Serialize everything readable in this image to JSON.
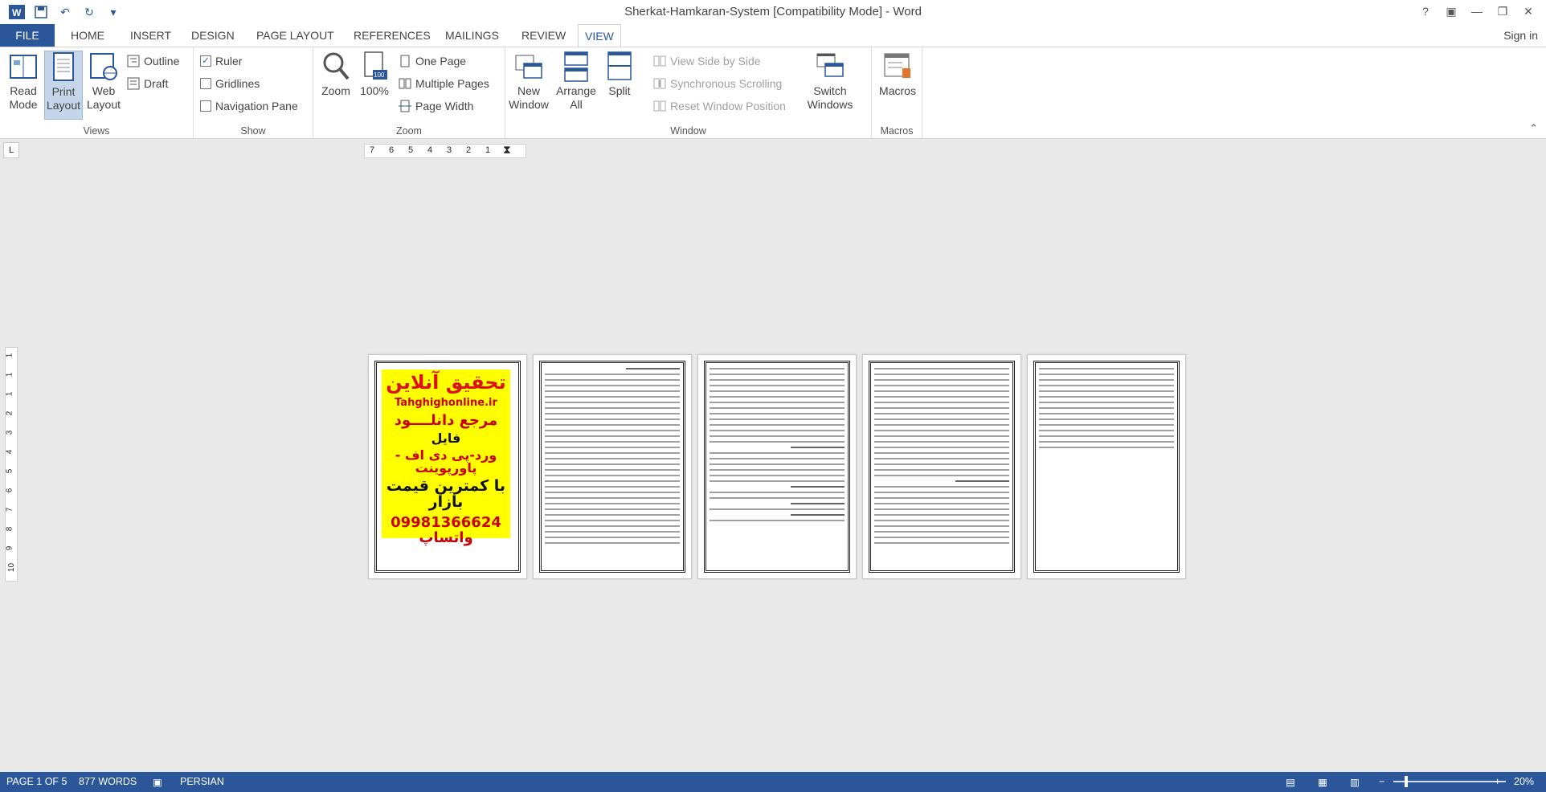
{
  "app": {
    "title": "Sherkat-Hamkaran-System [Compatibility Mode] - Word",
    "sign_in": "Sign in"
  },
  "tabs": [
    "FILE",
    "HOME",
    "INSERT",
    "DESIGN",
    "PAGE LAYOUT",
    "REFERENCES",
    "MAILINGS",
    "REVIEW",
    "VIEW"
  ],
  "active_tab": "VIEW",
  "ribbon": {
    "views": {
      "label": "Views",
      "read_mode": "Read Mode",
      "print_layout": "Print Layout",
      "web_layout": "Web Layout",
      "outline": "Outline",
      "draft": "Draft"
    },
    "show": {
      "label": "Show",
      "ruler": "Ruler",
      "ruler_checked": true,
      "gridlines": "Gridlines",
      "gridlines_checked": false,
      "nav_pane": "Navigation Pane",
      "nav_pane_checked": false
    },
    "zoom": {
      "label": "Zoom",
      "zoom": "Zoom",
      "hundred": "100%",
      "one_page": "One Page",
      "multiple_pages": "Multiple Pages",
      "page_width": "Page Width"
    },
    "window": {
      "label": "Window",
      "new_window": "New Window",
      "arrange_all": "Arrange All",
      "split": "Split",
      "side_by_side": "View Side by Side",
      "sync_scroll": "Synchronous Scrolling",
      "reset_pos": "Reset Window Position",
      "switch_windows": "Switch Windows"
    },
    "macros": {
      "label": "Macros",
      "macros": "Macros"
    }
  },
  "ruler": {
    "h_ticks": [
      "7",
      "6",
      "5",
      "4",
      "3",
      "2",
      "1"
    ],
    "v_ticks": [
      "1",
      "1",
      "1",
      "2",
      "3",
      "4",
      "5",
      "6",
      "7",
      "8",
      "9",
      "10"
    ]
  },
  "ad": {
    "line1": "تحقیق آنلاین",
    "line2": "Tahghighonline.ir",
    "line3": "مرجع دانلــــود",
    "line4": "فایل",
    "line5": "ورد-پی دی اف - پاورپوینت",
    "line6": "با کمترین قیمت بازار",
    "line7": "09981366624 واتساپ"
  },
  "status": {
    "page": "PAGE 1 OF 5",
    "words": "877 WORDS",
    "language": "PERSIAN",
    "zoom": "20%"
  }
}
